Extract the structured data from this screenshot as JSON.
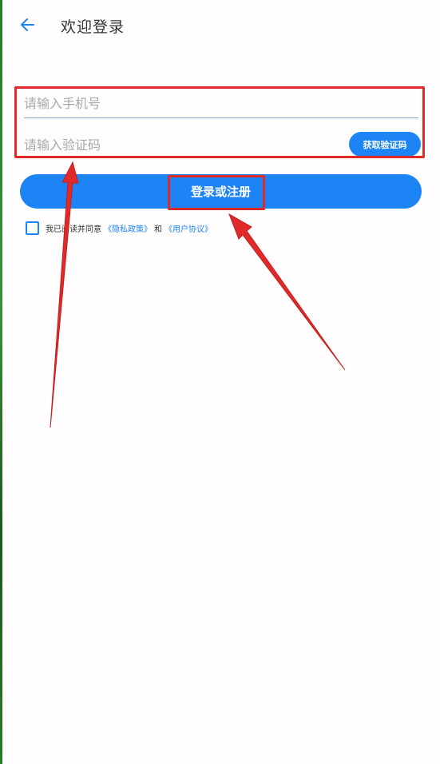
{
  "header": {
    "title": "欢迎登录",
    "back_icon": "arrow-left-icon"
  },
  "form": {
    "phone_placeholder": "请输入手机号",
    "code_placeholder": "请输入验证码",
    "get_code_label": "获取验证码",
    "login_label": "登录或注册"
  },
  "agreement": {
    "prefix": "我已阅读并同意",
    "privacy_link": "《隐私政策》",
    "and": "和",
    "user_link": "《用户协议》"
  },
  "colors": {
    "accent": "#1c84f5",
    "annotation": "#e02a2a"
  }
}
